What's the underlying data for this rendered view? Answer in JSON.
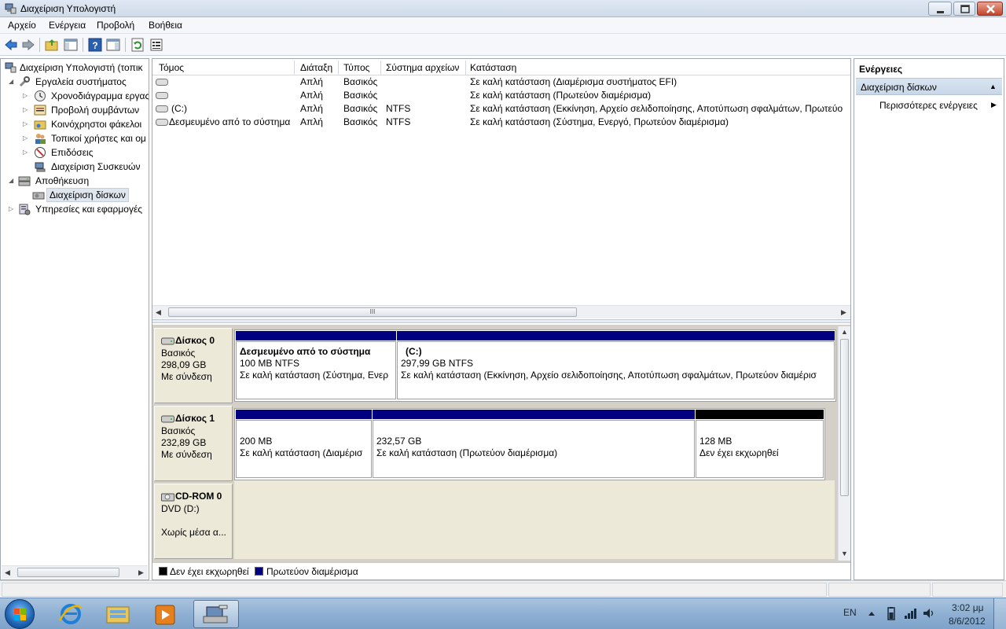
{
  "window": {
    "title": "Διαχείριση Υπολογιστή"
  },
  "menu": [
    "Αρχείο",
    "Ενέργεια",
    "Προβολή",
    "Βοήθεια"
  ],
  "tree": {
    "root": "Διαχείριση Υπολογιστή (τοπικ",
    "system_tools": "Εργαλεία συστήματος",
    "scheduler": "Χρονοδιάγραμμα εργας",
    "event_viewer": "Προβολή συμβάντων",
    "shared_folders": "Κοινόχρηστοι φάκελοι",
    "local_users": "Τοπικοί χρήστες και ομ",
    "performance": "Επιδόσεις",
    "device_manager": "Διαχείριση Συσκευών",
    "storage": "Αποθήκευση",
    "disk_management": "Διαχείριση δίσκων",
    "services": "Υπηρεσίες και εφαρμογές"
  },
  "volumes": {
    "columns": [
      "Τόμος",
      "Διάταξη",
      "Τύπος",
      "Σύστημα αρχείων",
      "Κατάσταση"
    ],
    "rows": [
      {
        "volume": "",
        "layout": "Απλή",
        "type": "Βασικός",
        "fs": "",
        "status": "Σε καλή κατάσταση (Διαμέρισμα συστήματος EFI)"
      },
      {
        "volume": "",
        "layout": "Απλή",
        "type": "Βασικός",
        "fs": "",
        "status": "Σε καλή κατάσταση (Πρωτεύον διαμέρισμα)"
      },
      {
        "volume": "(C:)",
        "layout": "Απλή",
        "type": "Βασικός",
        "fs": "NTFS",
        "status": "Σε καλή κατάσταση (Εκκίνηση, Αρχείο σελιδοποίησης, Αποτύπωση σφαλμάτων, Πρωτεύο"
      },
      {
        "volume": "Δεσμευμένο από το σύστημα",
        "layout": "Απλή",
        "type": "Βασικός",
        "fs": "NTFS",
        "status": "Σε καλή κατάσταση (Σύστημα, Ενεργό, Πρωτεύον διαμέρισμα)"
      }
    ],
    "scroll_grip": "III"
  },
  "disks": [
    {
      "name": "Δίσκος 0",
      "type": "Βασικός",
      "size": "298,09 GB",
      "state": "Με σύνδεση",
      "partitions": [
        {
          "title": "Δεσμευμένο από το σύστημα",
          "size": "100 MB NTFS",
          "status": "Σε καλή κατάσταση (Σύστημα, Ενερ",
          "color": "#000080"
        },
        {
          "title": "(C:)",
          "size": "297,99 GB NTFS",
          "status": "Σε καλή κατάσταση (Εκκίνηση, Αρχείο σελιδοποίησης, Αποτύπωση σφαλμάτων, Πρωτεύον διαμέρισ",
          "color": "#000080"
        }
      ]
    },
    {
      "name": "Δίσκος 1",
      "type": "Βασικός",
      "size": "232,89 GB",
      "state": "Με σύνδεση",
      "partitions": [
        {
          "size": "200 MB",
          "status": "Σε καλή κατάσταση (Διαμέρισ",
          "color": "#000080"
        },
        {
          "size": "232,57 GB",
          "status": "Σε καλή κατάσταση (Πρωτεύον διαμέρισμα)",
          "color": "#000080"
        },
        {
          "size": "128 MB",
          "status": "Δεν έχει εκχωρηθεί",
          "color": "#000000"
        }
      ]
    },
    {
      "name": "CD-ROM 0",
      "type": "DVD (D:)",
      "state": "Χωρίς μέσα α..."
    }
  ],
  "legend": {
    "unallocated": {
      "label": "Δεν έχει εκχωρηθεί",
      "color": "#000000"
    },
    "primary": {
      "label": "Πρωτεύον διαμέρισμα",
      "color": "#000080"
    }
  },
  "actions": {
    "title": "Ενέργειες",
    "section": "Διαχείριση δίσκων",
    "more": "Περισσότερες ενέργειες"
  },
  "taskbar": {
    "lang": "EN",
    "time": "3:02 μμ",
    "date": "8/6/2012"
  }
}
